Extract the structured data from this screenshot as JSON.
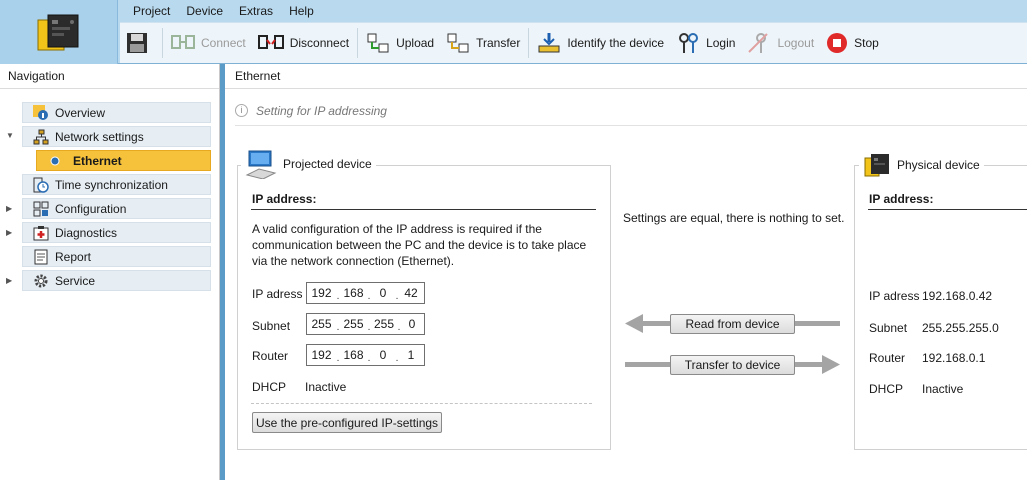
{
  "menu": [
    "Project",
    "Device",
    "Extras",
    "Help"
  ],
  "toolbar": {
    "connect": "Connect",
    "disconnect": "Disconnect",
    "upload": "Upload",
    "transfer": "Transfer",
    "identify": "Identify the device",
    "login": "Login",
    "logout": "Logout",
    "stop": "Stop"
  },
  "navigation": {
    "title": "Navigation",
    "items": [
      {
        "label": "Overview",
        "icon": "info-icon"
      },
      {
        "label": "Network settings",
        "icon": "network-icon"
      },
      {
        "label": "Ethernet",
        "icon": "bullet-icon",
        "selected": true
      },
      {
        "label": "Time synchronization",
        "icon": "clock-icon"
      },
      {
        "label": "Configuration",
        "icon": "configuration-icon"
      },
      {
        "label": "Diagnostics",
        "icon": "diagnostics-icon"
      },
      {
        "label": "Report",
        "icon": "report-icon"
      },
      {
        "label": "Service",
        "icon": "gear-icon"
      }
    ]
  },
  "main": {
    "title": "Ethernet",
    "info": "Setting for IP addressing",
    "projected": {
      "title": "Projected device",
      "section": "IP address:",
      "description": "A valid configuration of the IP address is required if the communication between the PC and the device is to take place via the network connection (Ethernet).",
      "ip_label": "IP adress",
      "ip": [
        "192",
        "168",
        "0",
        "42"
      ],
      "subnet_label": "Subnet",
      "subnet": [
        "255",
        "255",
        "255",
        "0"
      ],
      "router_label": "Router",
      "router": [
        "192",
        "168",
        "0",
        "1"
      ],
      "dhcp_label": "DHCP",
      "dhcp_value": "Inactive",
      "preconfig_button": "Use the pre-configured IP-settings"
    },
    "compare_message": "Settings are equal, there is nothing to set.",
    "read_button": "Read from device",
    "transfer_button": "Transfer to device",
    "physical": {
      "title": "Physical device",
      "section": "IP address:",
      "ip_label": "IP adress",
      "ip_value": "192.168.0.42",
      "subnet_label": "Subnet",
      "subnet_value": "255.255.255.0",
      "router_label": "Router",
      "router_value": "192.168.0.1",
      "dhcp_label": "DHCP",
      "dhcp_value": "Inactive"
    }
  },
  "colors": {
    "accent": "#5a9bc8",
    "selected_nav": "#f6c23c",
    "stop_red": "#e02a2a"
  }
}
